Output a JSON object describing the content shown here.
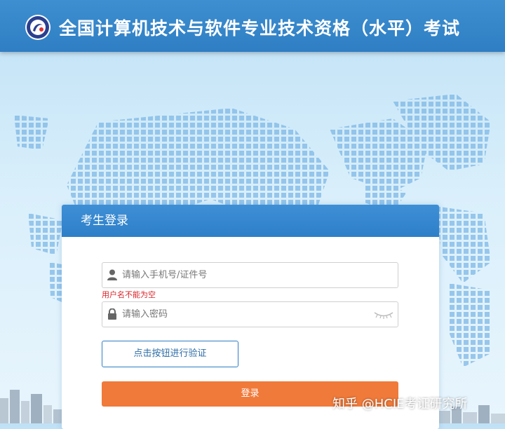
{
  "header": {
    "title": "全国计算机技术与软件专业技术资格（水平）考试",
    "logo_icon": "exam-seal-icon"
  },
  "login": {
    "title": "考生登录",
    "username": {
      "placeholder": "请输入手机号/证件号",
      "value": "",
      "icon": "user-icon"
    },
    "error": "用户名不能为空",
    "password": {
      "placeholder": "请输入密码",
      "value": "",
      "icon": "lock-icon",
      "toggle_icon": "eye-closed-icon"
    },
    "verify_label": "点击按钮进行验证",
    "submit_label": "登录"
  },
  "watermark": "知乎 @HCIE考证研究所",
  "colors": {
    "header_bg": "#2f7ec4",
    "panel_head_bg": "#2d7fc8",
    "error": "#d9252b",
    "login_button": "#f07a3a",
    "page_bg": "#d9effb"
  }
}
